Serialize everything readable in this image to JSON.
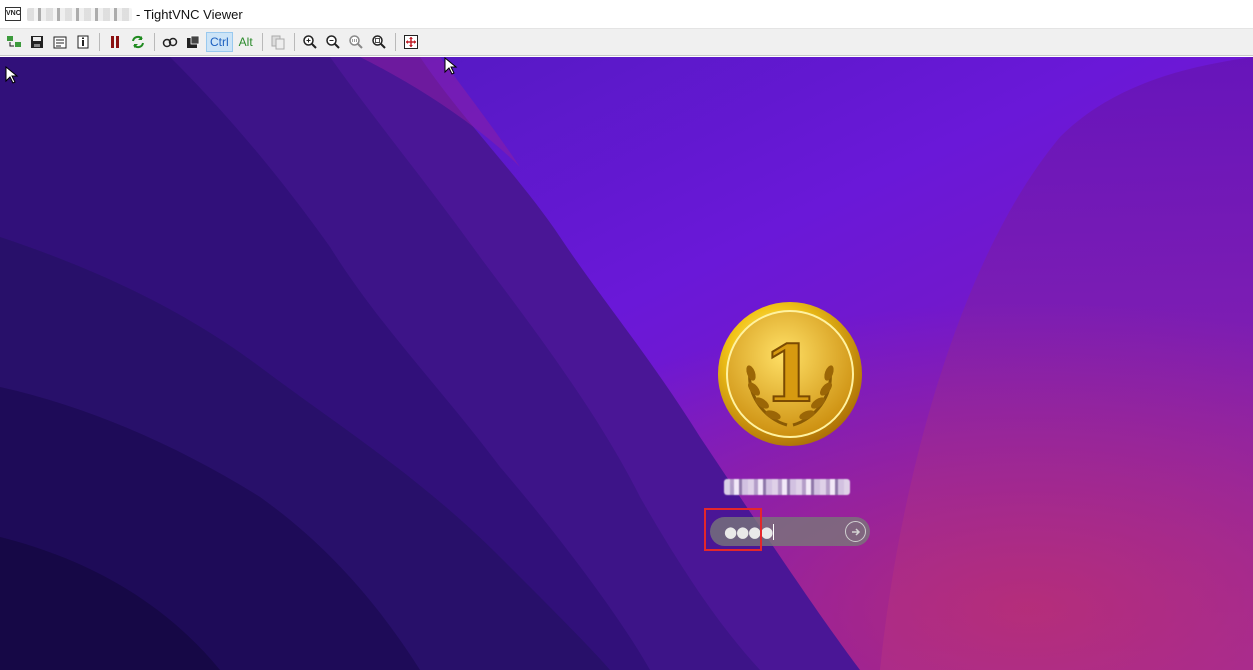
{
  "window": {
    "title": "- TightVNC Viewer",
    "app_icon_text": "VNC"
  },
  "toolbar": {
    "items": [
      {
        "name": "new-connection-icon"
      },
      {
        "name": "save-icon"
      },
      {
        "name": "options-icon"
      },
      {
        "name": "connection-info-icon"
      },
      {
        "name": "pause-icon"
      },
      {
        "name": "refresh-icon"
      },
      {
        "name": "ctrl-alt-del-icon"
      },
      {
        "name": "ctrl-esc-icon"
      }
    ],
    "ctrl_label": "Ctrl",
    "alt_label": "Alt",
    "zoom_items": [
      {
        "name": "transfer-files-icon"
      },
      {
        "name": "zoom-in-icon"
      },
      {
        "name": "zoom-out-icon"
      },
      {
        "name": "zoom-100-icon"
      },
      {
        "name": "zoom-fit-icon"
      },
      {
        "name": "fullscreen-icon"
      }
    ]
  },
  "login": {
    "avatar": "gold-medal-number-1",
    "avatar_number": "1",
    "password_value": "●●●●",
    "submit_icon": "arrow-right-circle-icon"
  },
  "colors": {
    "desktop_bg": "#5a1ad0",
    "highlight": "#e4272b"
  }
}
